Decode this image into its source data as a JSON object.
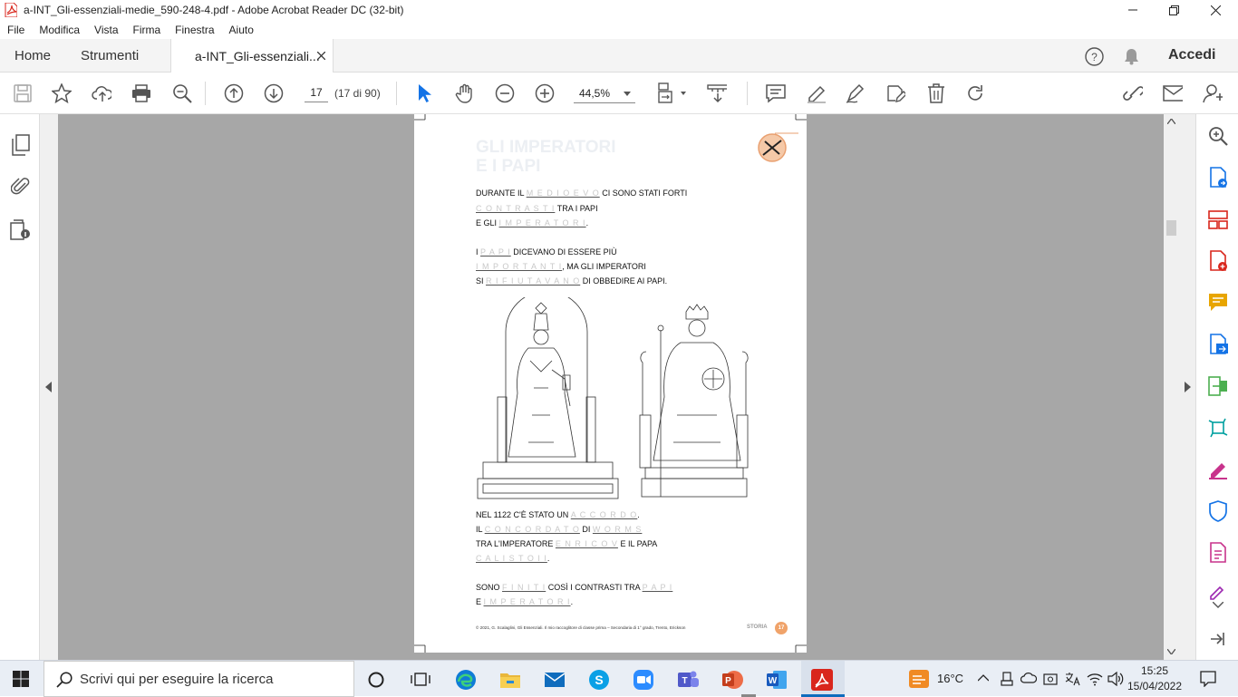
{
  "window": {
    "title": "a-INT_Gli-essenziali-medie_590-248-4.pdf - Adobe Acrobat Reader DC (32-bit)"
  },
  "menu": [
    "File",
    "Modifica",
    "Vista",
    "Firma",
    "Finestra",
    "Aiuto"
  ],
  "tabs": {
    "home": "Home",
    "tools": "Strumenti",
    "document": "a-INT_Gli-essenziali...",
    "sign_in": "Accedi"
  },
  "toolbar": {
    "page_number": "17",
    "page_count": "(17 di 90)",
    "zoom": "44,5%"
  },
  "document": {
    "title_line1": "GLI IMPERATORI",
    "title_line2": "E I PAPI",
    "s1a": "DURANTE IL",
    "b1": "M E D I O E V O",
    "s1b": "CI SONO STATI FORTI",
    "b2": "C O N T R A S T I",
    "s2": "TRA I PAPI",
    "s3": "E GLI",
    "b3": "I M P E R A T O R I",
    "s4a": "I",
    "b4": "P A P I",
    "s4b": "DICEVANO DI ESSERE PIÙ",
    "b5": "I M P O R T A N T I",
    "s5": ", MA GLI IMPERATORI",
    "s6a": "SI",
    "b6": "R I F I U T A V A N O",
    "s6b": "DI OBBEDIRE AI PAPI.",
    "s7": "NEL 1122 C'È STATO UN",
    "b7": "A C C O R D O",
    "s8": "IL",
    "b8": "C O N C O R D A T O",
    "s8b": "DI",
    "b9": "W O R M S",
    "s9": "TRA L'IMPERATORE",
    "b10": "E N R I C O  V",
    "s9b": "E IL PAPA",
    "b11": "C A L I S T O  I I",
    "s10": "SONO",
    "b12": "F I N I T I",
    "s10b": "COSÌ I CONTRASTI TRA",
    "b13": "P A P I",
    "s11": "E",
    "b14": "I M P E R A T O R I",
    "footer_credit": "© 2021, G. Scalaglini, Gli Essenziali. Il mio raccoglitore di classe prima – Secondaria di 1° grado, Trento, Erickson",
    "footer_section": "STORIA",
    "footer_page": "17"
  },
  "taskbar": {
    "search_placeholder": "Scrivi qui per eseguire la ricerca",
    "weather": "16°C",
    "time": "15:25",
    "date": "15/04/2022"
  },
  "colors": {
    "acrobat_red": "#d9261c",
    "accent_blue": "#1473e6",
    "viewer_bg": "#a7a7a7",
    "right_icon_colors": [
      "#1473e6",
      "#d9261c",
      "#d9261c",
      "#e8a500",
      "#1473e6",
      "#4caf50",
      "#00a0a0",
      "#c8338c",
      "#1473e6",
      "#c8338c",
      "#9c27b0"
    ]
  }
}
